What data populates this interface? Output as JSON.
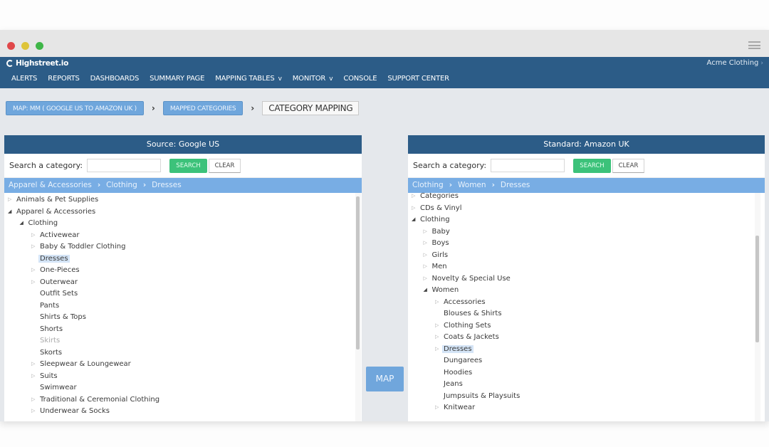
{
  "window": {
    "controls": [
      "close",
      "minimize",
      "maximize"
    ],
    "menu_icon": "hamburger-icon"
  },
  "app": {
    "logo_text": "Highstreet.io",
    "account": "Acme Clothing",
    "nav": [
      {
        "label": "ALERTS",
        "dropdown": false
      },
      {
        "label": "REPORTS",
        "dropdown": false
      },
      {
        "label": "DASHBOARDS",
        "dropdown": false
      },
      {
        "label": "SUMMARY PAGE",
        "dropdown": false
      },
      {
        "label": "MAPPING TABLES",
        "dropdown": true
      },
      {
        "label": "MONITOR",
        "dropdown": true
      },
      {
        "label": "CONSOLE",
        "dropdown": false
      },
      {
        "label": "SUPPORT CENTER",
        "dropdown": false
      }
    ],
    "dropdown_glyph": "v"
  },
  "breadcrumb": {
    "items": [
      "MAP: MM ( GOOGLE US TO AMAZON UK )",
      "MAPPED CATEGORIES"
    ],
    "current": "CATEGORY MAPPING",
    "separator": "›"
  },
  "source_panel": {
    "title": "Source: Google US",
    "search_label": "Search a category:",
    "search_value": "",
    "search_button": "SEARCH",
    "clear_button": "CLEAR",
    "path": [
      "Apparel & Accessories",
      "Clothing",
      "Dresses"
    ],
    "tree": [
      {
        "label": "Animals & Pet Supplies",
        "level": 0,
        "toggle": "closed"
      },
      {
        "label": "Apparel & Accessories",
        "level": 0,
        "toggle": "open"
      },
      {
        "label": "Clothing",
        "level": 1,
        "toggle": "open"
      },
      {
        "label": "Activewear",
        "level": 2,
        "toggle": "closed"
      },
      {
        "label": "Baby & Toddler Clothing",
        "level": 2,
        "toggle": "closed"
      },
      {
        "label": "Dresses",
        "level": 2,
        "toggle": "none",
        "selected": true
      },
      {
        "label": "One-Pieces",
        "level": 2,
        "toggle": "closed"
      },
      {
        "label": "Outerwear",
        "level": 2,
        "toggle": "closed"
      },
      {
        "label": "Outfit Sets",
        "level": 2,
        "toggle": "none"
      },
      {
        "label": "Pants",
        "level": 2,
        "toggle": "none"
      },
      {
        "label": "Shirts & Tops",
        "level": 2,
        "toggle": "none"
      },
      {
        "label": "Shorts",
        "level": 2,
        "toggle": "none"
      },
      {
        "label": "Skirts",
        "level": 2,
        "toggle": "none",
        "muted": true
      },
      {
        "label": "Skorts",
        "level": 2,
        "toggle": "none"
      },
      {
        "label": "Sleepwear & Loungewear",
        "level": 2,
        "toggle": "closed"
      },
      {
        "label": "Suits",
        "level": 2,
        "toggle": "closed"
      },
      {
        "label": "Swimwear",
        "level": 2,
        "toggle": "none"
      },
      {
        "label": "Traditional & Ceremonial Clothing",
        "level": 2,
        "toggle": "closed"
      },
      {
        "label": "Underwear & Socks",
        "level": 2,
        "toggle": "closed"
      }
    ],
    "scroll_position": 0.0
  },
  "map_button": "MAP",
  "target_panel": {
    "title": "Standard: Amazon UK",
    "search_label": "Search a category:",
    "search_value": "",
    "search_button": "SEARCH",
    "clear_button": "CLEAR",
    "path": [
      "Clothing",
      "Women",
      "Dresses"
    ],
    "tree": [
      {
        "label": "Categories",
        "level": 0,
        "toggle": "closed"
      },
      {
        "label": "CDs & Vinyl",
        "level": 0,
        "toggle": "closed"
      },
      {
        "label": "Clothing",
        "level": 0,
        "toggle": "open"
      },
      {
        "label": "Baby",
        "level": 1,
        "toggle": "closed"
      },
      {
        "label": "Boys",
        "level": 1,
        "toggle": "closed"
      },
      {
        "label": "Girls",
        "level": 1,
        "toggle": "closed"
      },
      {
        "label": "Men",
        "level": 1,
        "toggle": "closed"
      },
      {
        "label": "Novelty & Special Use",
        "level": 1,
        "toggle": "closed"
      },
      {
        "label": "Women",
        "level": 1,
        "toggle": "open"
      },
      {
        "label": "Accessories",
        "level": 2,
        "toggle": "closed"
      },
      {
        "label": "Blouses & Shirts",
        "level": 2,
        "toggle": "none"
      },
      {
        "label": "Clothing Sets",
        "level": 2,
        "toggle": "closed"
      },
      {
        "label": "Coats & Jackets",
        "level": 2,
        "toggle": "closed"
      },
      {
        "label": "Dresses",
        "level": 2,
        "toggle": "closed",
        "selected": true
      },
      {
        "label": "Dungarees",
        "level": 2,
        "toggle": "none"
      },
      {
        "label": "Hoodies",
        "level": 2,
        "toggle": "none"
      },
      {
        "label": "Jeans",
        "level": 2,
        "toggle": "none"
      },
      {
        "label": "Jumpsuits & Playsuits",
        "level": 2,
        "toggle": "none"
      },
      {
        "label": "Knitwear",
        "level": 2,
        "toggle": "closed"
      }
    ],
    "scroll_position": 0.35
  }
}
